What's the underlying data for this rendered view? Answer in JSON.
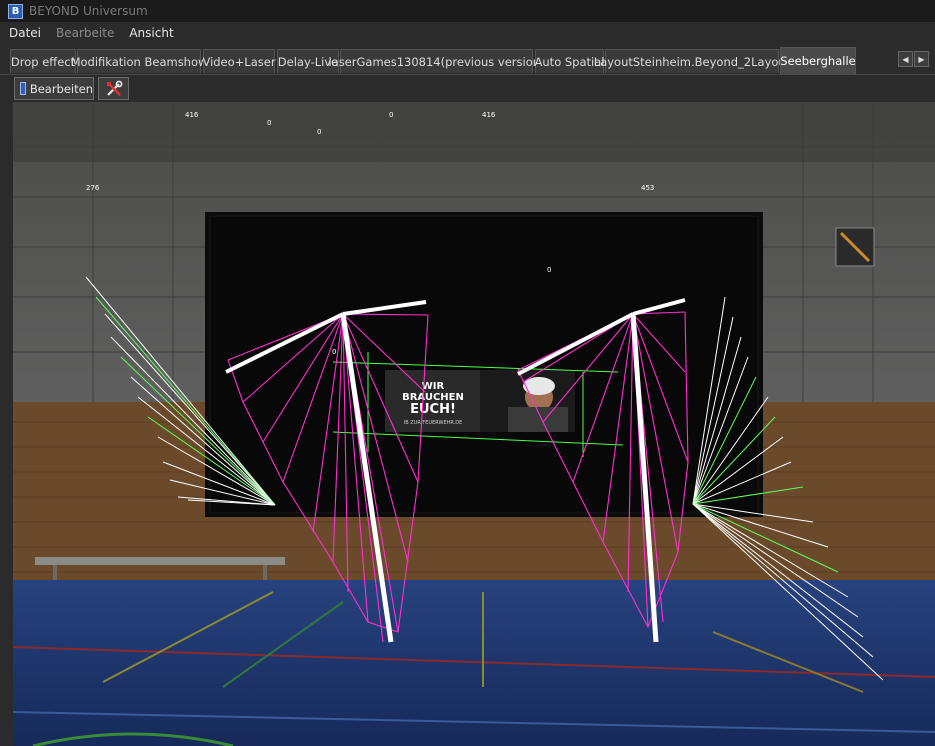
{
  "app": {
    "title": "BEYOND Universum",
    "logo_icon": "beyond-logo-icon"
  },
  "menu": [
    {
      "label": "Datei",
      "disabled": false
    },
    {
      "label": "Bearbeite",
      "disabled": true
    },
    {
      "label": "Ansicht",
      "disabled": false
    }
  ],
  "tabs": [
    {
      "label": "Drop effect"
    },
    {
      "label": "Modifikation Beamshow"
    },
    {
      "label": "Video+Laser"
    },
    {
      "label": "Delay-Live"
    },
    {
      "label": "laserGames130814(previous version)"
    },
    {
      "label": "Auto Spatial"
    },
    {
      "label": "LayoutSteinheim.Beyond_2Layout"
    },
    {
      "label": "Seeberghalle",
      "active": true
    }
  ],
  "tab_scroll": {
    "left_icon": "chevron-left-icon",
    "right_icon": "chevron-right-icon",
    "left_glyph": "◀",
    "right_glyph": "▶"
  },
  "toolbar": {
    "edit_label": "Bearbeiten",
    "edit_icon": "edit-icon",
    "tools_icon": "tools-icon"
  },
  "scene": {
    "screen_text": {
      "line1": "WIR",
      "line2": "BRAUCHEN",
      "line3": "EUCH!",
      "line4": "IB ZUR FEUERWEHR.DE"
    },
    "projector_labels": [
      "416",
      "0",
      "0",
      "0",
      "416",
      "276",
      "453",
      "0",
      "0"
    ],
    "colors": {
      "beam_magenta": "#ff2fd0",
      "beam_white": "#ffffff",
      "beam_green": "#5cff5c",
      "floor": "#1f3a78",
      "wall": "#5a5a58",
      "wood": "#7a5632"
    }
  }
}
